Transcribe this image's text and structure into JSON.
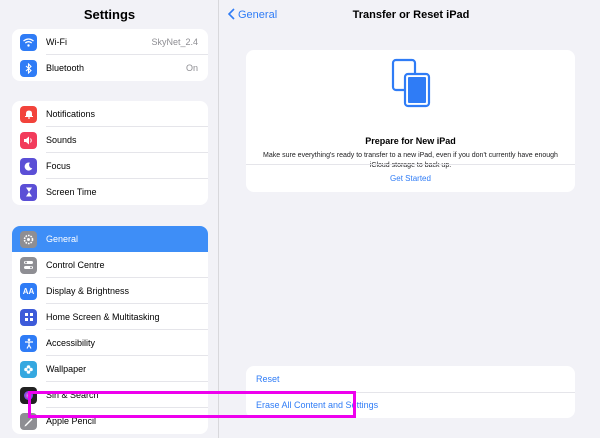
{
  "sidebar": {
    "title": "Settings",
    "group1": [
      {
        "label": "Wi-Fi",
        "value": "SkyNet_2.4",
        "icon": "wifi-icon",
        "color": "#2f7cf6"
      },
      {
        "label": "Bluetooth",
        "value": "On",
        "icon": "bluetooth-icon",
        "color": "#2f7cf6"
      }
    ],
    "group2": [
      {
        "label": "Notifications",
        "icon": "bell-icon",
        "color": "#f2433b"
      },
      {
        "label": "Sounds",
        "icon": "speaker-icon",
        "color": "#f23b5b"
      },
      {
        "label": "Focus",
        "icon": "moon-icon",
        "color": "#5b4fd6"
      },
      {
        "label": "Screen Time",
        "icon": "hourglass-icon",
        "color": "#5b4fd6"
      }
    ],
    "group3": [
      {
        "label": "General",
        "icon": "gear-icon",
        "color": "#8e8e93",
        "selected": true
      },
      {
        "label": "Control Centre",
        "icon": "toggles-icon",
        "color": "#8e8e93"
      },
      {
        "label": "Display & Brightness",
        "icon": "aa-icon",
        "color": "#2f7cf6"
      },
      {
        "label": "Home Screen & Multitasking",
        "icon": "grid-icon",
        "color": "#3d5bd9"
      },
      {
        "label": "Accessibility",
        "icon": "accessibility-icon",
        "color": "#2f7cf6"
      },
      {
        "label": "Wallpaper",
        "icon": "flower-icon",
        "color": "#35a8e0"
      },
      {
        "label": "Siri & Search",
        "icon": "siri-icon",
        "color": "#222"
      },
      {
        "label": "Apple Pencil",
        "icon": "pencil-icon",
        "color": "#8e8e93"
      }
    ]
  },
  "detail": {
    "back_label": "General",
    "title": "Transfer or Reset iPad",
    "card": {
      "title": "Prepare for New iPad",
      "description": "Make sure everything's ready to transfer to a new iPad, even if you don't currently have enough iCloud storage to back up.",
      "link": "Get Started"
    },
    "reset_label": "Reset",
    "erase_label": "Erase All Content and Settings"
  },
  "colors": {
    "accent": "#2f7cf6",
    "highlight": "#ee00ee",
    "selected": "#3e8ef7"
  }
}
